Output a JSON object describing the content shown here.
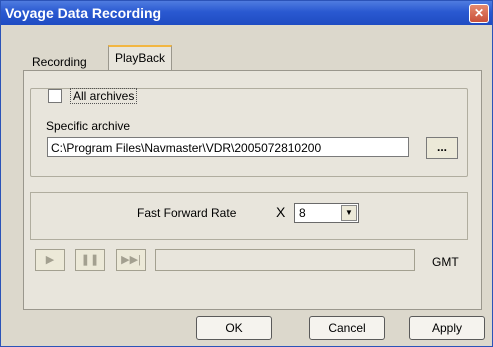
{
  "window": {
    "title": "Voyage Data Recording"
  },
  "tabs": [
    {
      "label": "Recording",
      "active": false
    },
    {
      "label": "PlayBack",
      "active": true
    }
  ],
  "archive": {
    "all_archives_label": "All archives",
    "all_archives_checked": false,
    "specific_label": "Specific archive",
    "path": "C:\\Program Files\\Navmaster\\VDR\\2005072810200",
    "browse_label": "..."
  },
  "playback": {
    "ff_rate_label": "Fast Forward Rate",
    "times_sign": "X",
    "ff_rate_value": "8",
    "gmt_label": "GMT"
  },
  "buttons": {
    "ok": "OK",
    "cancel": "Cancel",
    "apply": "Apply"
  },
  "icons": {
    "play": "play-icon",
    "pause": "pause-icon",
    "fast_forward": "fast-forward-icon"
  }
}
